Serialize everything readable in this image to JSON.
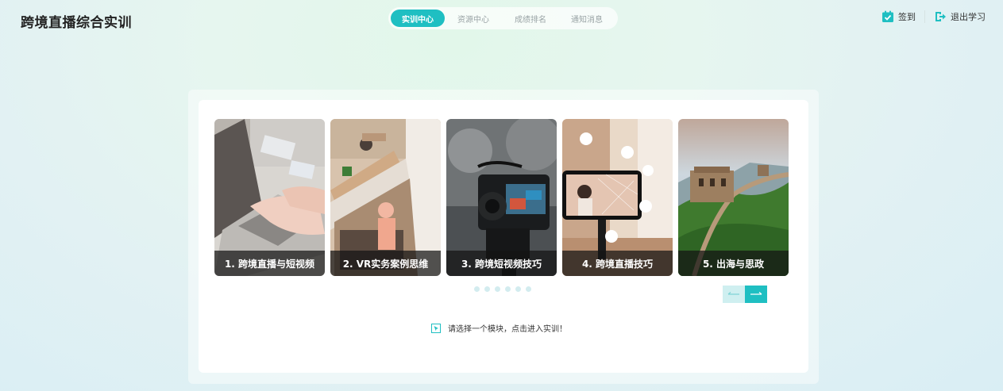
{
  "app": {
    "title": "跨境直播综合实训"
  },
  "nav": {
    "tabs": [
      {
        "label": "实训中心",
        "active": true
      },
      {
        "label": "资源中心",
        "active": false
      },
      {
        "label": "成绩排名",
        "active": false
      },
      {
        "label": "通知消息",
        "active": false
      }
    ]
  },
  "header": {
    "sign_in": "签到",
    "exit": "退出学习"
  },
  "modules": [
    {
      "label": "1. 跨境直播与短视频",
      "image": "laptop-typing"
    },
    {
      "label": "2. VR实务案例思维",
      "image": "clothing-store"
    },
    {
      "label": "3. 跨境短视频技巧",
      "image": "video-camera"
    },
    {
      "label": "4. 跨境直播技巧",
      "image": "phone-livestream"
    },
    {
      "label": "5. 出海与思政",
      "image": "great-wall"
    }
  ],
  "hint": {
    "text": "请选择一个模块，点击进入实训！"
  },
  "colors": {
    "accent": "#1fbfc2",
    "accent_light": "#cfeff0"
  }
}
